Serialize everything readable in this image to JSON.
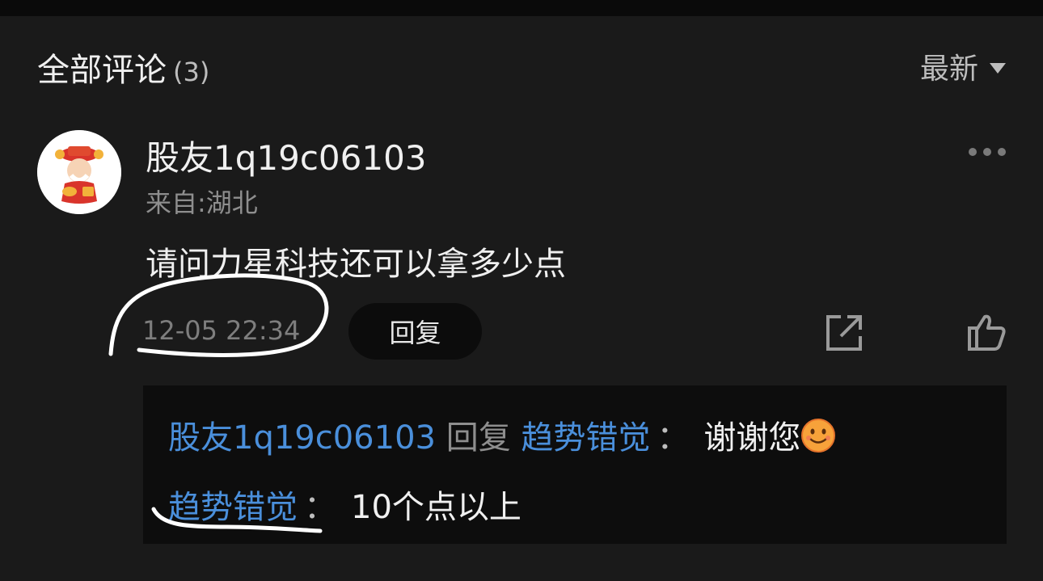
{
  "header": {
    "title": "全部评论",
    "count": "(3)",
    "sort_label": "最新"
  },
  "comment": {
    "username": "股友1q19c06103",
    "location": "来自:湖北",
    "content": "请问力星科技还可以拿多少点",
    "time": "12-05 22:34",
    "reply_label": "回复"
  },
  "replies": [
    {
      "from": "股友1q19c06103",
      "verb": "回复",
      "to": "趋势错觉",
      "colon": "：",
      "text": "谢谢您",
      "emoji": "smile-emoji"
    },
    {
      "from": "趋势错觉",
      "colon": "：",
      "text": "10个点以上"
    }
  ],
  "colors": {
    "background": "#1a1a1a",
    "link_blue": "#4a8fdb",
    "reply_panel": "#0d0d0d"
  }
}
